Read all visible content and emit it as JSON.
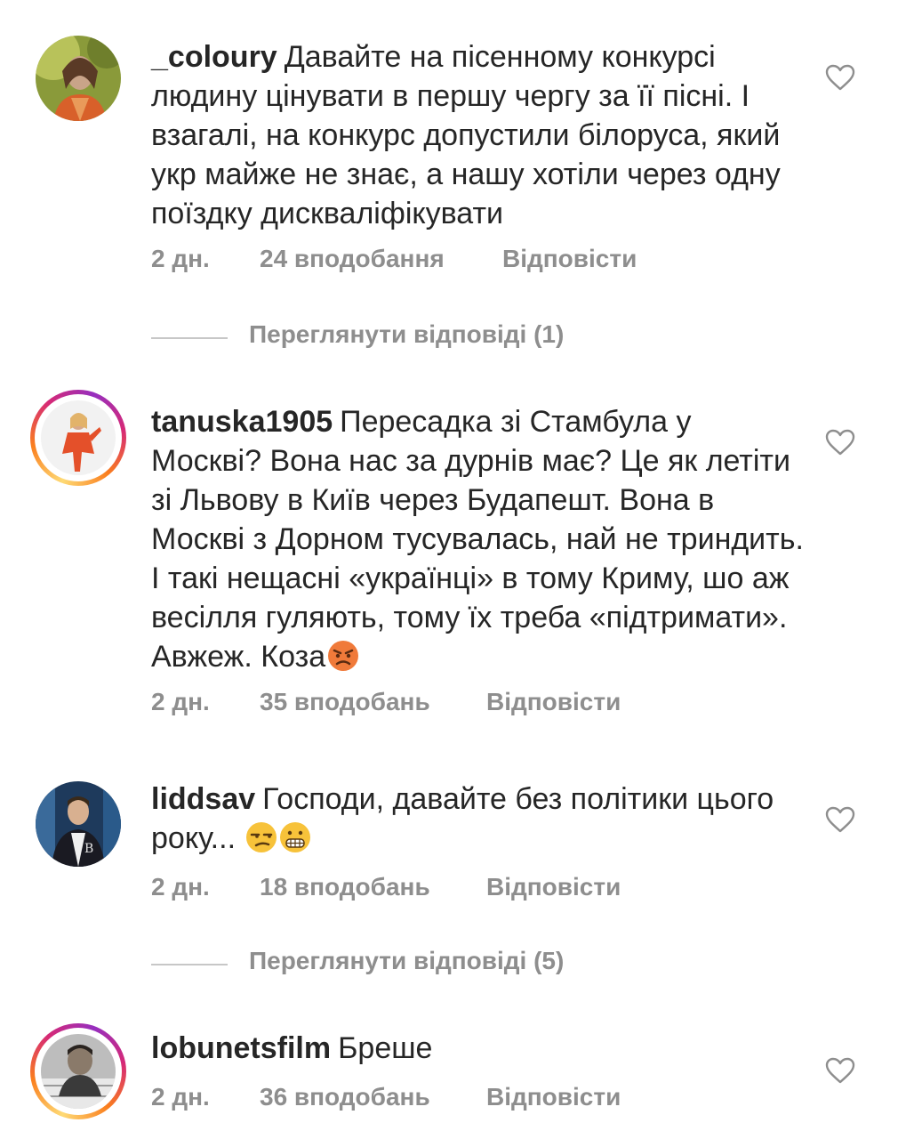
{
  "comments": [
    {
      "username": "_coloury",
      "text": "Давайте на пісенному конкурсі людину цінувати в першу чергу за її пісні. І взагалі, на конкурс допустили білоруса, який укр майже не знає, а нашу хотіли через одну поїздку дискваліфікувати",
      "time": "2 дн.",
      "likes": "24 вподобання",
      "reply": "Відповісти",
      "view_replies": "Переглянути відповіді (1)"
    },
    {
      "username": "tanuska1905",
      "text": "Пересадка зі Стамбула у Москві? Вона нас за дурнів має? Це як летіти зі Львову в Київ через Будапешт. Вона в Москві з Дорном тусувалась, най не триндить. І такі нещасні «українці» в тому Криму, шо аж весілля гуляють, тому їх треба «підтримати». Авжеж. Коза",
      "time": "2 дн.",
      "likes": "35 вподобань",
      "reply": "Відповісти"
    },
    {
      "username": "liddsav",
      "text": "Господи, давайте без політики цього року...",
      "time": "2 дн.",
      "likes": "18 вподобань",
      "reply": "Відповісти",
      "view_replies": "Переглянути відповіді (5)"
    },
    {
      "username": "lobunetsfilm",
      "text": "Бреше",
      "time": "2 дн.",
      "likes": "36 вподобань",
      "reply": "Відповісти"
    }
  ],
  "icons": {
    "like": "heart-outline-icon",
    "emoji_angry": "angry-face-emoji",
    "emoji_unamused": "unamused-face-emoji",
    "emoji_grimacing": "grimacing-face-emoji"
  },
  "colors": {
    "text": "#262626",
    "secondary": "#8e8e8e",
    "story_ring": "#d62976"
  }
}
